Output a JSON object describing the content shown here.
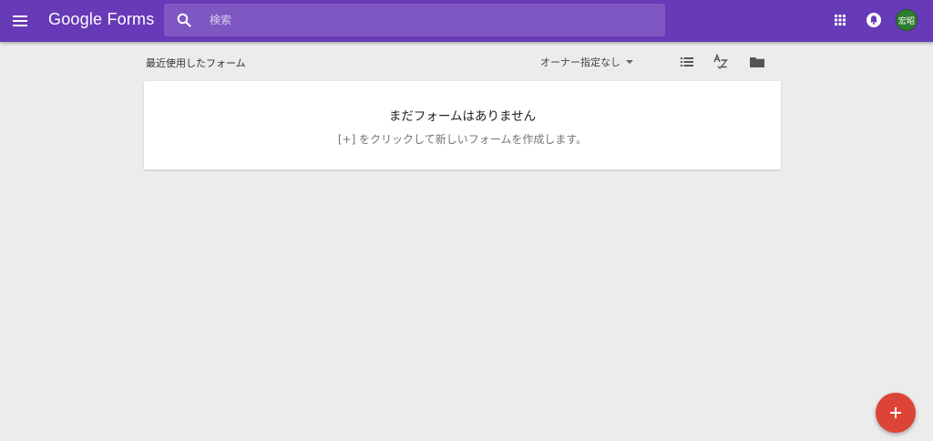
{
  "header": {
    "app_title": "Google Forms",
    "search_placeholder": "検索",
    "avatar_initials": "宏昭"
  },
  "icons": {
    "menu": "hamburger-menu-icon",
    "search": "search-icon",
    "apps": "apps-grid-icon",
    "notifications": "notifications-icon",
    "list_view": "list-view-icon",
    "sort": "sort-az-icon",
    "folder": "folder-icon",
    "add": "plus-icon"
  },
  "toolbar": {
    "section_title": "最近使用したフォーム",
    "owner_filter": "オーナー指定なし"
  },
  "empty_state": {
    "title": "まだフォームはありません",
    "hint": "[+] をクリックして新しいフォームを作成します。"
  },
  "colors": {
    "brand": "#673ab7",
    "search_bg": "#7e57c2",
    "fab": "#db4437",
    "avatar": "#2f7d32",
    "page_bg": "#ececec"
  }
}
